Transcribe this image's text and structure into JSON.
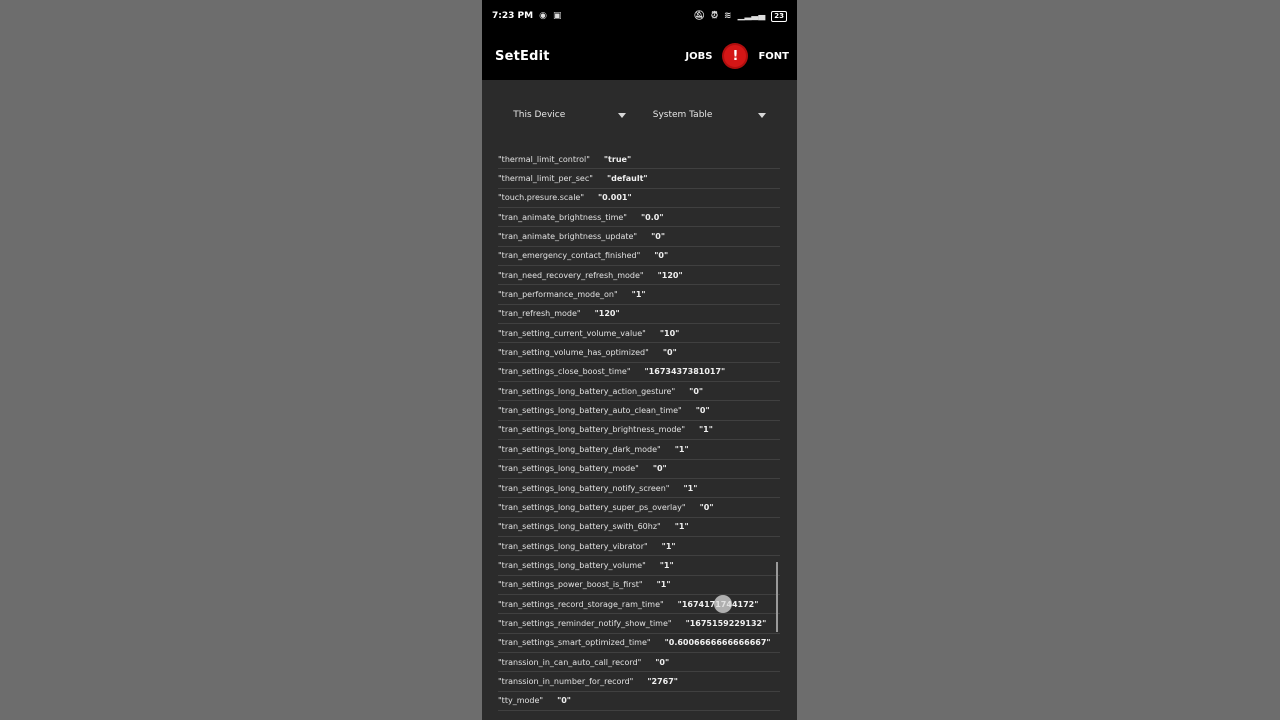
{
  "status": {
    "time": "7:23 PM",
    "battery": "23"
  },
  "app": {
    "title": "SetEdit",
    "jobs_label": "JOBS",
    "alert_glyph": "!",
    "font_label": "FONT"
  },
  "selectors": {
    "device": "This Device",
    "table": "System Table"
  },
  "rows": [
    {
      "key": "\"thermal_limit_control\"",
      "value": "\"true\""
    },
    {
      "key": "\"thermal_limit_per_sec\"",
      "value": "\"default\""
    },
    {
      "key": "\"touch.presure.scale\"",
      "value": "\"0.001\""
    },
    {
      "key": "\"tran_animate_brightness_time\"",
      "value": "\"0.0\""
    },
    {
      "key": "\"tran_animate_brightness_update\"",
      "value": "\"0\""
    },
    {
      "key": "\"tran_emergency_contact_finished\"",
      "value": "\"0\""
    },
    {
      "key": "\"tran_need_recovery_refresh_mode\"",
      "value": "\"120\""
    },
    {
      "key": "\"tran_performance_mode_on\"",
      "value": "\"1\""
    },
    {
      "key": "\"tran_refresh_mode\"",
      "value": "\"120\""
    },
    {
      "key": "\"tran_setting_current_volume_value\"",
      "value": "\"10\""
    },
    {
      "key": "\"tran_setting_volume_has_optimized\"",
      "value": "\"0\""
    },
    {
      "key": "\"tran_settings_close_boost_time\"",
      "value": "\"1673437381017\""
    },
    {
      "key": "\"tran_settings_long_battery_action_gesture\"",
      "value": "\"0\""
    },
    {
      "key": "\"tran_settings_long_battery_auto_clean_time\"",
      "value": "\"0\""
    },
    {
      "key": "\"tran_settings_long_battery_brightness_mode\"",
      "value": "\"1\""
    },
    {
      "key": "\"tran_settings_long_battery_dark_mode\"",
      "value": "\"1\""
    },
    {
      "key": "\"tran_settings_long_battery_mode\"",
      "value": "\"0\""
    },
    {
      "key": "\"tran_settings_long_battery_notify_screen\"",
      "value": "\"1\""
    },
    {
      "key": "\"tran_settings_long_battery_super_ps_overlay\"",
      "value": "\"0\""
    },
    {
      "key": "\"tran_settings_long_battery_swith_60hz\"",
      "value": "\"1\""
    },
    {
      "key": "\"tran_settings_long_battery_vibrator\"",
      "value": "\"1\""
    },
    {
      "key": "\"tran_settings_long_battery_volume\"",
      "value": "\"1\""
    },
    {
      "key": "\"tran_settings_power_boost_is_first\"",
      "value": "\"1\""
    },
    {
      "key": "\"tran_settings_record_storage_ram_time\"",
      "value": "\"1674171744172\""
    },
    {
      "key": "\"tran_settings_reminder_notify_show_time\"",
      "value": "\"1675159229132\""
    },
    {
      "key": "\"tran_settings_smart_optimized_time\"",
      "value": "\"0.6006666666666667\""
    },
    {
      "key": "\"transsion_in_can_auto_call_record\"",
      "value": "\"0\""
    },
    {
      "key": "\"transsion_in_number_for_record\"",
      "value": "\"2767\""
    },
    {
      "key": "\"tty_mode\"",
      "value": "\"0\""
    }
  ]
}
